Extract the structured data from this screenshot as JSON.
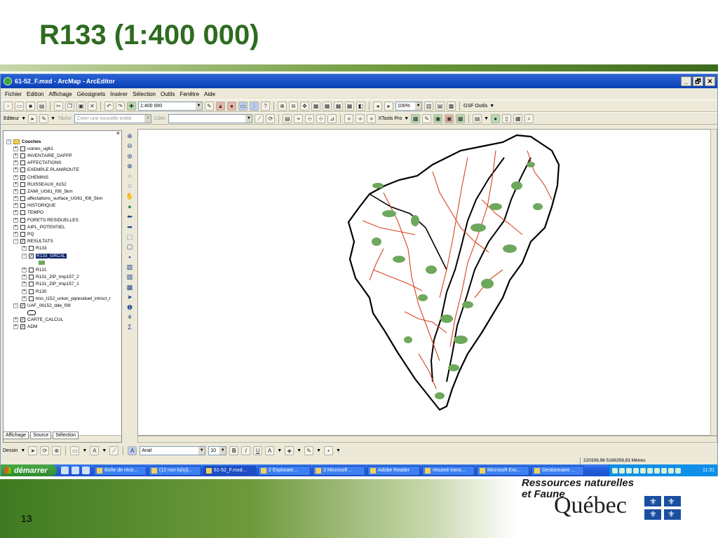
{
  "slide": {
    "title": "R133 (1:400 000)",
    "page_number": "13",
    "brand_line1": "Ressources naturelles",
    "brand_line2": "et Faune",
    "brand_name": "Québec"
  },
  "window": {
    "title": "61-52_F.mxd - ArcMap - ArcEditor",
    "controls": [
      "_",
      "🗗",
      "✕"
    ]
  },
  "menu": [
    "Fichier",
    "Edition",
    "Affichage",
    "Géosignets",
    "Insérer",
    "Sélection",
    "Outils",
    "Fenêtre",
    "Aide"
  ],
  "toolbar1": {
    "scale": "1:400 000",
    "zoom": "100%",
    "gsf_outils": "GSF Outils"
  },
  "toolbar2": {
    "editeur": "Editeur",
    "tache_label": "Tâche:",
    "tache_value": "Créer une nouvelle entité",
    "cible_label": "Cible:",
    "xtools": "XTools Pro"
  },
  "toc": {
    "root": "Couches",
    "layers": [
      {
        "name": "usines_ug61",
        "checked": false
      },
      {
        "name": "INVENTAIRE_DAFPP",
        "checked": false
      },
      {
        "name": "AFFECTATIONS",
        "checked": false
      },
      {
        "name": "EXEMPLE PLANIROUTE",
        "checked": false
      },
      {
        "name": "CHEMINS",
        "checked": true
      },
      {
        "name": "RUISSEAUX_6152",
        "checked": false
      },
      {
        "name": "ZAMI_UG61_f08_5km",
        "checked": false
      },
      {
        "name": "affectations_surface_UG61_f08_5km",
        "checked": false
      },
      {
        "name": "HISTORIQUE",
        "checked": false
      },
      {
        "name": "TEMPO",
        "checked": false
      },
      {
        "name": "FORETS RESIDUELLES",
        "checked": false
      },
      {
        "name": "AIPL_POTENTIEL",
        "checked": false
      },
      {
        "name": "PQ",
        "checked": false
      },
      {
        "name": "RESULTATS",
        "checked": true
      }
    ],
    "sublayers": [
      {
        "name": "R133",
        "checked": false
      },
      {
        "name": "R133_GRCAL",
        "checked": true
      },
      {
        "name": "R131",
        "checked": false
      },
      {
        "name": "R131_ZIP_tmp157_2",
        "checked": false
      },
      {
        "name": "R131_ZIP_tmp157_1",
        "checked": false
      },
      {
        "name": "R130",
        "checked": false
      },
      {
        "name": "tmo_t152_union_pqresiduel_intrsct_r",
        "checked": false
      }
    ],
    "bottom_layers": [
      {
        "name": "UAF_06152_dde_f08",
        "checked": true
      },
      {
        "name": "CARTE_CALCUL",
        "checked": true
      },
      {
        "name": "ADM",
        "checked": true
      }
    ],
    "tabs": [
      "Affichage",
      "Source",
      "Sélection"
    ]
  },
  "drawbar": {
    "dessin": "Dessin",
    "font": "Arial",
    "size": "10"
  },
  "status": {
    "coords": "220339,98  5186358,83 Mètres"
  },
  "taskbar": {
    "start": "démarrer",
    "tasks": [
      "Boîte de réce...",
      "(12 non lu(s))...",
      "61-52_F.mxd...",
      "2 Explorate...",
      "3 Microsoft ...",
      "Adobe Reader",
      "résumé trans...",
      "Microsoft Exc...",
      "Gestionnaire ..."
    ],
    "time": "11:31"
  },
  "colors": {
    "slide_green": "#2e6b1f",
    "xp_blue": "#245edb",
    "road_red": "#d9431e",
    "forest_green": "#6ea85c"
  }
}
